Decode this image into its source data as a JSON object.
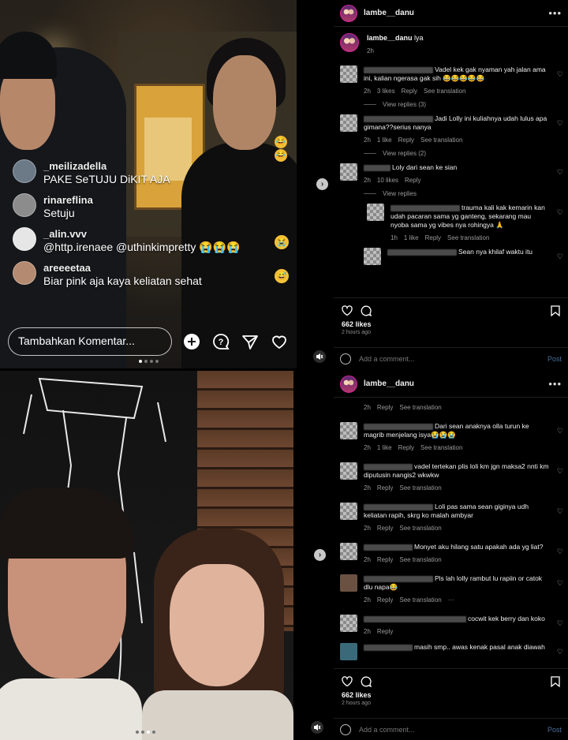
{
  "top_video": {
    "live_comments": [
      {
        "user": "_meilizadella",
        "text": "PAKE SeTUJU DiKIT AJA",
        "avatar_color": "#6c7a88",
        "emoji": ""
      },
      {
        "user": "rinareflina",
        "text": "Setuju",
        "avatar_color": "#8c8c8c",
        "emoji": ""
      },
      {
        "user": "_alin.vvv",
        "text": "@http.irenaee @uthinkimpretty 😭😭😭",
        "avatar_color": "#e6e6e6",
        "emoji": "😭"
      },
      {
        "user": "areeeetaa",
        "text": "Biar pink aja kaya keliatan sehat",
        "avatar_color": "#b48a70",
        "emoji": "😅"
      }
    ],
    "comment_placeholder": "Tambahkan Komentar..."
  },
  "ig_top": {
    "username": "lambe__danu",
    "caption": {
      "user": "lambe__danu",
      "text": "lya",
      "time": "2h"
    },
    "comments": [
      {
        "text": "Vadel kek gak nyaman yah jalan ama ini, kalian ngerasa gak sih 😂😂😂😂😂",
        "time": "2h",
        "likes": "3 likes",
        "reply": "Reply",
        "translate": "See translation",
        "view_replies": "View replies (3)"
      },
      {
        "text": "Jadi Lolly ini kuliahnya udah lulus apa gimana??serius nanya",
        "time": "2h",
        "likes": "1 like",
        "reply": "Reply",
        "translate": "See translation",
        "view_replies": "View replies (2)"
      },
      {
        "text": "Loly dari sean ke sian",
        "time": "2h",
        "likes": "10 likes",
        "reply": "Reply",
        "translate": "",
        "view_replies": "View replies"
      },
      {
        "text": "trauma kali kak kemarin kan udah pacaran sama yg ganteng, sekarang mau nyoba sama yg vibes nya rohingya 🙏",
        "time": "1h",
        "likes": "1 like",
        "reply": "Reply",
        "translate": "See translation",
        "view_replies": ""
      },
      {
        "text": "Sean nya khilaf waktu itu",
        "time": "",
        "likes": "",
        "reply": "",
        "translate": "",
        "view_replies": ""
      }
    ],
    "likes": "662 likes",
    "ago": "2 hours ago",
    "add_comment": "Add a comment...",
    "post": "Post"
  },
  "ig_bottom": {
    "username": "lambe__danu",
    "top_meta": {
      "time": "2h",
      "reply": "Reply",
      "translate": "See translation"
    },
    "comments": [
      {
        "text": "Dari sean anaknya olla turun ke magrib menjelang isya😭😭😭",
        "time": "2h",
        "likes": "1 like",
        "reply": "Reply",
        "translate": "See translation",
        "extra": ""
      },
      {
        "text": "vadel tertekan plis loli km jgn maksa2 nnti km diputusin nangis2 wkwkw",
        "time": "2h",
        "likes": "",
        "reply": "Reply",
        "translate": "See translation",
        "extra": ""
      },
      {
        "text": "Loli pas sama sean giginya udh keliatan rapih, skrg ko malah ambyar",
        "time": "2h",
        "likes": "",
        "reply": "Reply",
        "translate": "See translation",
        "extra": ""
      },
      {
        "text": "Monyet aku hilang satu apakah ada yg liat?",
        "time": "2h",
        "likes": "",
        "reply": "Reply",
        "translate": "See translation",
        "extra": ""
      },
      {
        "text": "Pls lah lolly rambut lu rapiin or catok dlu napa😂",
        "time": "2h",
        "likes": "",
        "reply": "Reply",
        "translate": "See translation",
        "extra": "···"
      },
      {
        "text": "cocwit kek berry dan koko",
        "time": "2h",
        "likes": "",
        "reply": "Reply",
        "translate": "",
        "extra": ""
      },
      {
        "text": "masih smp.. awas kenak pasal anak diawah",
        "time": "",
        "likes": "",
        "reply": "",
        "translate": "",
        "extra": ""
      }
    ],
    "likes": "662 likes",
    "ago": "2 hours ago",
    "add_comment": "Add a comment...",
    "post": "Post"
  }
}
